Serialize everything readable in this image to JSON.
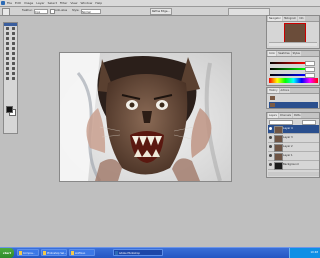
{
  "menubar": {
    "items": [
      "File",
      "Edit",
      "Image",
      "Layer",
      "Select",
      "Filter",
      "View",
      "Window",
      "Help"
    ]
  },
  "options": {
    "feather_label": "Feather:",
    "feather_value": "0 px",
    "anti_alias_label": "Anti-alias",
    "style_label": "Style:",
    "style_value": "Normal",
    "refine_label": "Refine Edge..."
  },
  "panels": {
    "navigator_tabs": [
      "Navigator",
      "Histogram",
      "Info"
    ],
    "color_tabs": [
      "Color",
      "Swatches",
      "Styles"
    ],
    "history_tabs": [
      "History",
      "Actions"
    ],
    "layers_tabs": [
      "Layers",
      "Channels",
      "Paths"
    ],
    "layers_blend": "Normal",
    "layers_opacity": "100%",
    "layers": [
      {
        "name": "Layer 4",
        "selected": true
      },
      {
        "name": "Layer 3",
        "selected": false
      },
      {
        "name": "Layer 2",
        "selected": false
      },
      {
        "name": "Layer 1",
        "selected": false
      },
      {
        "name": "Background",
        "selected": false
      }
    ],
    "history_items": [
      "Open",
      "Layer Via Copy"
    ]
  },
  "taskbar": {
    "start_label": "start",
    "tasks": [
      {
        "label": "Compos...",
        "active": false
      },
      {
        "label": "Photoshop Sel...",
        "active": false
      },
      {
        "label": "wolfman",
        "active": false
      },
      {
        "label": "Adobe Photoshop",
        "active": true
      }
    ],
    "clock": "10:48"
  },
  "colors": {
    "accent": "#2a4f8e",
    "taskbar": "#2456c2"
  }
}
